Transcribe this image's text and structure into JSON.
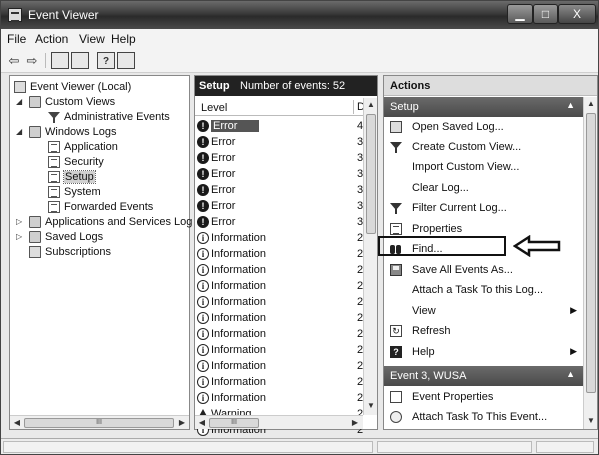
{
  "window": {
    "title": "Event Viewer",
    "min_label": "▁",
    "max_label": "□",
    "close_label": "X"
  },
  "menu": {
    "file": "File",
    "action": "Action",
    "view": "View",
    "help": "Help"
  },
  "toolbar": {
    "back": "⇦",
    "forward": "⇨",
    "help_glyph": "?"
  },
  "tree": {
    "root": "Event Viewer (Local)",
    "custom_views": "Custom Views",
    "admin_events": "Administrative Events",
    "windows_logs": "Windows Logs",
    "application": "Application",
    "security": "Security",
    "setup": "Setup",
    "system": "System",
    "forwarded": "Forwarded Events",
    "app_services": "Applications and Services Log",
    "saved_logs": "Saved Logs",
    "subscriptions": "Subscriptions",
    "scroll_thumb": "III"
  },
  "events": {
    "title": "Setup",
    "count_label": "Number of events: 52",
    "col_level": "Level",
    "col_date": "D",
    "scroll_thumb": "III",
    "rows": [
      {
        "level": "Error",
        "type": "error",
        "cnt": "4"
      },
      {
        "level": "Error",
        "type": "error",
        "cnt": "3"
      },
      {
        "level": "Error",
        "type": "error",
        "cnt": "3"
      },
      {
        "level": "Error",
        "type": "error",
        "cnt": "3"
      },
      {
        "level": "Error",
        "type": "error",
        "cnt": "3"
      },
      {
        "level": "Error",
        "type": "error",
        "cnt": "3"
      },
      {
        "level": "Error",
        "type": "error",
        "cnt": "3"
      },
      {
        "level": "Information",
        "type": "info",
        "cnt": "2"
      },
      {
        "level": "Information",
        "type": "info",
        "cnt": "2"
      },
      {
        "level": "Information",
        "type": "info",
        "cnt": "2"
      },
      {
        "level": "Information",
        "type": "info",
        "cnt": "2"
      },
      {
        "level": "Information",
        "type": "info",
        "cnt": "2"
      },
      {
        "level": "Information",
        "type": "info",
        "cnt": "2"
      },
      {
        "level": "Information",
        "type": "info",
        "cnt": "2"
      },
      {
        "level": "Information",
        "type": "info",
        "cnt": "2"
      },
      {
        "level": "Information",
        "type": "info",
        "cnt": "2"
      },
      {
        "level": "Information",
        "type": "info",
        "cnt": "2"
      },
      {
        "level": "Information",
        "type": "info",
        "cnt": "2"
      },
      {
        "level": "Warning",
        "type": "warn",
        "cnt": "2"
      },
      {
        "level": "Information",
        "type": "info",
        "cnt": "2"
      }
    ]
  },
  "actions": {
    "header": "Actions",
    "section1": "Setup",
    "section2": "Event 3, WUSA",
    "open_saved": "Open Saved Log...",
    "create_custom": "Create Custom View...",
    "import_custom": "Import Custom View...",
    "clear_log": "Clear Log...",
    "filter_log": "Filter Current Log...",
    "properties": "Properties",
    "find": "Find...",
    "save_all": "Save All Events As...",
    "attach_task_log": "Attach a Task To this Log...",
    "view": "View",
    "refresh": "Refresh",
    "help": "Help",
    "event_properties": "Event Properties",
    "attach_task_event": "Attach Task To This Event..."
  }
}
